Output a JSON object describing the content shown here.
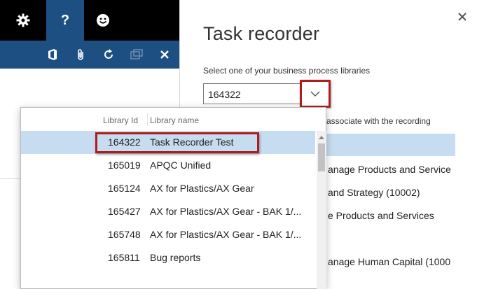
{
  "topbar": {
    "gear_icon": "gear-icon",
    "help_label": "?",
    "smile_icon": "smiley-icon"
  },
  "actionbar": {
    "icons": [
      "office-icon",
      "attachment-icon",
      "refresh-icon",
      "popout-icon",
      "close-icon"
    ]
  },
  "panel": {
    "title": "Task recorder",
    "select_label": "Select one of your business process libraries",
    "combo_value": "164322",
    "assoc_text": "associate with the recording",
    "tree_items": [
      "anage Products and Service",
      "and Strategy (10002)",
      "e Products and Services",
      "anage Human Capital (1000"
    ]
  },
  "dropdown": {
    "header_id": "Library Id",
    "header_name": "Library name",
    "rows": [
      {
        "id": "164322",
        "name": "Task Recorder Test"
      },
      {
        "id": "165019",
        "name": "APQC Unified"
      },
      {
        "id": "165124",
        "name": "AX for Plastics/AX Gear"
      },
      {
        "id": "165427",
        "name": "AX for Plastics/AX Gear - BAK 1/..."
      },
      {
        "id": "165748",
        "name": "AX for Plastics/AX Gear - BAK 1/..."
      },
      {
        "id": "165811",
        "name": "Bug reports"
      }
    ],
    "selected_index": 0
  },
  "colors": {
    "accent_blue": "#1e4f82",
    "highlight_red": "#b01c1c",
    "selection_blue": "#c6dcf0"
  }
}
